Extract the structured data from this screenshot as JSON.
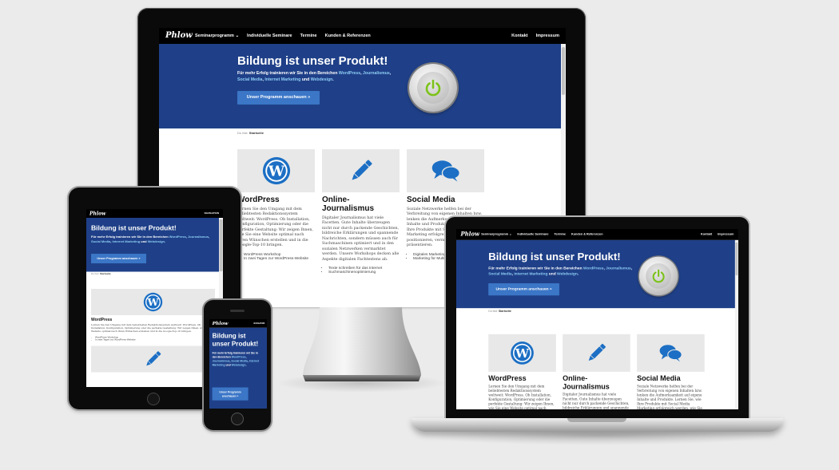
{
  "site": {
    "logo": "Phlow",
    "nav": [
      "Seminarprogramm",
      "Individuelle Seminare",
      "Termine",
      "Kunden & Referenzen"
    ],
    "nav_short_mobile": "NAVIGATION",
    "nav_right": [
      "Kontakt",
      "Impressum"
    ],
    "dropdown_caret": "⌄",
    "hero_title": "Bildung ist unser Produkt!",
    "hero_sub_prefix": "Für mehr Erfolg trainieren wir Sie in den Bereichen ",
    "hero_links": [
      "WordPress",
      "Journalismus",
      "Social Media",
      "Internet Marketing"
    ],
    "hero_and": "und",
    "hero_last_link": "Webdesign",
    "hero_button": "Unser Programm anschauen »",
    "breadcrumb_label": "Du bist:",
    "breadcrumb_current": "Startseite",
    "cards": [
      {
        "icon": "wordpress-icon",
        "title": "WordPress",
        "text": "Lernen Sie den Umgang mit dem beliebtesten Redaktionssystem weltweit: WordPress. Ob Installation, Konfiguration, Optimierung oder die perfekte Gestaltung: Wir zeigen Ihnen, wie Sie eine Website optimal nach Ihren Wünschen erstellen und in die Google-Top-10 bringen.",
        "bullets": [
          "WordPress Workshop",
          "In zwei Tagen zur WordPress-Website"
        ]
      },
      {
        "icon": "pencil-icon",
        "title": "Online-Journalismus",
        "text": "Digitaler Journalismus hat viele Facetten. Gute Inhalte überzeugen nicht nur durch packende Geschichten, bildreiche Erklärungen und spannende Nachrichten, sondern müssen auch für Suchmaschinen optimiert und in den sozialen Netzwerken vermarktet werden. Unsere Workshops decken alle Aspekte digitalen Fachtextens ab.",
        "bullets": [
          "Texte schreiben für das Internet",
          "Suchmaschinenoptimierung"
        ]
      },
      {
        "icon": "chat-bubbles-icon",
        "title": "Social Media",
        "text": "Soziale Netzwerke helfen bei der Verbreitung von eigenen Inhalten bzw. lenken die Aufmerksamkeit auf eigene Inhalte und Produkte. Lernen Sie, wie Ihre Produkte mit Social Media Marketing erfolgreich werden, wie Sie positionieren, vermarkten und präsentieren.",
        "bullets": [
          "Digitales Marketing",
          "Marketing für Multiplikatoren"
        ]
      }
    ]
  },
  "colors": {
    "hero": "#1f4088",
    "button": "#3b76c7",
    "link": "#8fcdf5",
    "icon_blue": "#1c6fc4",
    "power_green": "#7cc21a",
    "nav": "#000000",
    "background": "#ebebeb"
  },
  "devices": [
    "imac",
    "ipad",
    "iphone",
    "macbook"
  ]
}
